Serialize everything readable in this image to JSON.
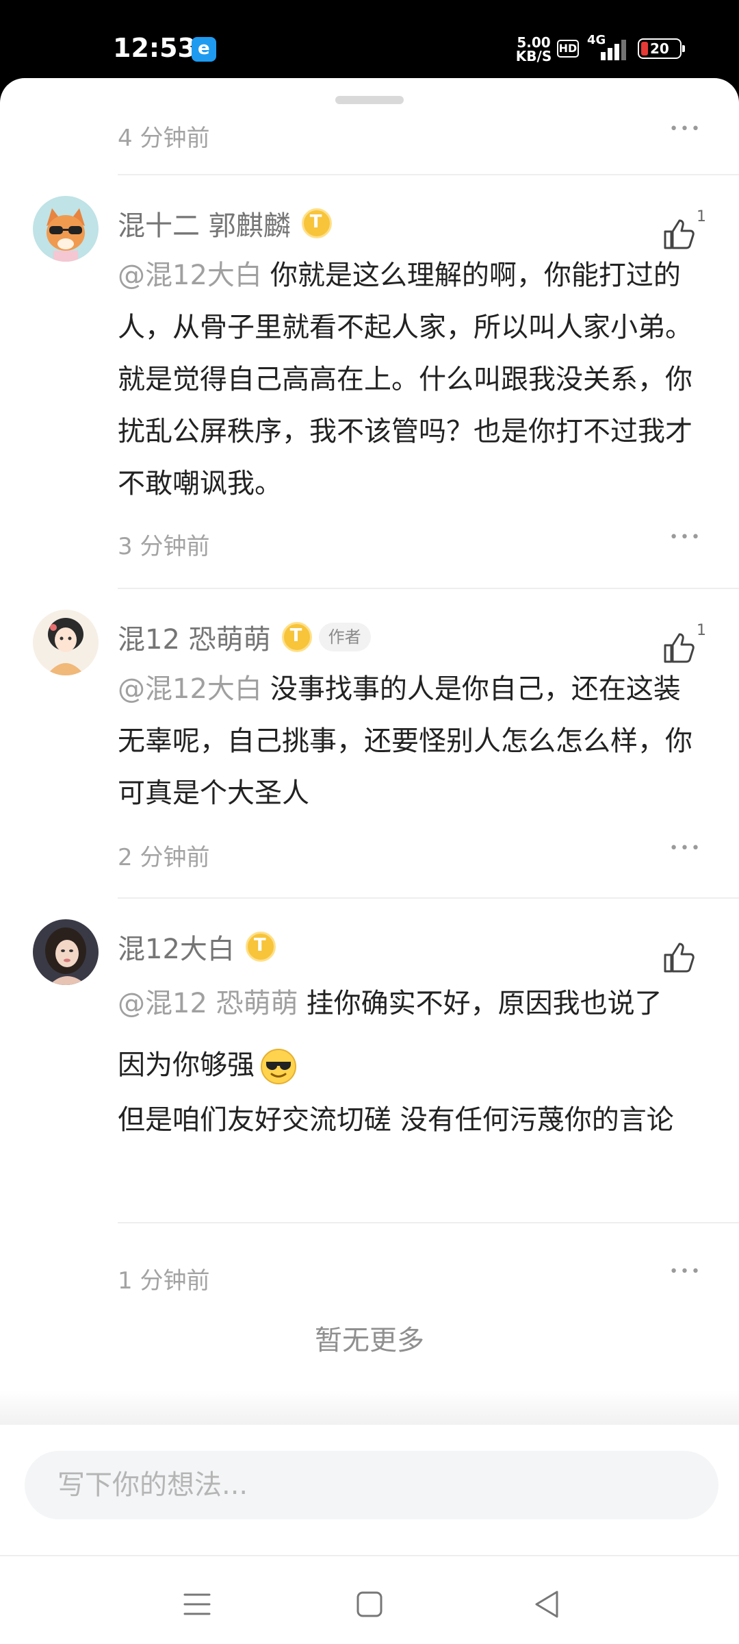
{
  "status_bar": {
    "time": "12:53",
    "net_speed_value": "5.00",
    "net_speed_unit": "KB/S",
    "hd_label": "HD",
    "network_label": "4G",
    "battery_level": "20",
    "battery_color": "#e53935"
  },
  "top_meta": {
    "time": "4 分钟前"
  },
  "comments": [
    {
      "name": "混十二 郭麒麟",
      "mention": "@混12大白",
      "text": "你就是这么理解的啊，你能打过的人，从骨子里就看不起人家，所以叫人家小弟。就是觉得自己高高在上。什么叫跟我没关系，你扰乱公屏秩序，我不该管吗？也是你打不过我才不敢嘲讽我。",
      "time": "3 分钟前",
      "likes": "1"
    },
    {
      "name": "混12 恐萌萌",
      "author_tag": "作者",
      "mention": "@混12大白",
      "text": "没事找事的人是你自己，还在这装无辜呢，自己挑事，还要怪别人怎么怎么样，你可真是个大圣人",
      "time": "2 分钟前",
      "likes": "1"
    },
    {
      "name": "混12大白",
      "mention": "@混12 恐萌萌",
      "text": "挂你确实不好，原因我也说了",
      "text_line2": "因为你够强",
      "text_line3": "但是咱们友好交流切磋 没有任何污蔑你的言论",
      "time": "1 分钟前",
      "likes": ""
    }
  ],
  "no_more": "暂无更多",
  "input": {
    "placeholder": "写下你的想法..."
  },
  "icons": {
    "level_badge": "level-badge-icon",
    "like": "thumbs-up-icon",
    "more": "more-dots-icon",
    "emoji": "sunglasses-emoji-icon"
  }
}
